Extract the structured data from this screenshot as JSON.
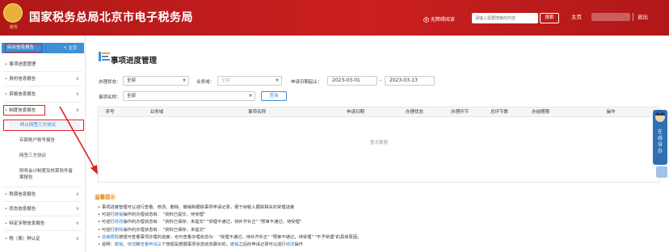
{
  "header": {
    "emblem_caption": "税务",
    "title": "国家税务总局北京市电子税务局",
    "accessibility": "无障碍阅读",
    "search_placeholder": "请输入需要搜索的内容",
    "search_button": "搜索",
    "home": "主页",
    "logout": "退出"
  },
  "sidebar": {
    "top_label": "综合信息报告",
    "home": "主页",
    "items": [
      {
        "label": "事项进度管理",
        "arrow": ""
      },
      {
        "label": "身份信息报告",
        "arrow": "∨"
      },
      {
        "label": "资格信息报告",
        "arrow": "∨"
      },
      {
        "label": "制度信息报告",
        "arrow": "∧"
      },
      {
        "label": "税源信息报告",
        "arrow": "∨"
      },
      {
        "label": "状态信息报告",
        "arrow": "∨"
      },
      {
        "label": "特定涉税信息报告",
        "arrow": "∨"
      },
      {
        "label": "税（费）种认定",
        "arrow": "∨"
      }
    ],
    "subitems": [
      "终止网签三方协议",
      "存款账户账号报告",
      "网签三方协议",
      "财务会计制度及核算软件备",
      "案报告"
    ]
  },
  "main": {
    "title": "事项进度管理",
    "filters": {
      "status_label": "办理状态：",
      "status_value": "全部",
      "domain_label": "业务域：",
      "domain_value": "全部",
      "date_label": "申请日期起止：",
      "date_from": "2023-03-01",
      "date_sep": "-",
      "date_to": "2023-03-13",
      "item_label": "事项名称：",
      "item_value": "全部",
      "query_button": "查询"
    },
    "table": {
      "columns": [
        "序号",
        "业务域",
        "事项名称",
        "申请日期",
        "办理状态",
        "办理环节",
        "总环节数",
        "办结期限",
        "操作"
      ],
      "empty_text": "暂无数据"
    }
  },
  "tips": {
    "title": "温馨提示",
    "lines": [
      [
        {
          "t": "事项进度管理可以进行查看、修改、删除、撤销和跟踪事项申请记录，便于纳税人跟踪相关的受理进度",
          "k": false
        }
      ],
      [
        {
          "t": "可进行",
          "k": false
        },
        {
          "t": "撤销",
          "k": true
        },
        {
          "t": "操作的办理状态有：  \"资料已提交，待受理\"",
          "k": false
        }
      ],
      [
        {
          "t": "可进行",
          "k": false
        },
        {
          "t": "修改",
          "k": true
        },
        {
          "t": "操作的办理状态有：  \"资料已保存，未提交\"    \"受理不通过，待补齐补正\"    \"预审不通过，待受理\"",
          "k": false
        }
      ],
      [
        {
          "t": "可进行",
          "k": false
        },
        {
          "t": "删除",
          "k": true
        },
        {
          "t": "操作的办理状态有：  \"资料已保存，未提交\"",
          "k": false
        }
      ],
      [
        {
          "t": "进度跟踪",
          "k": true
        },
        {
          "t": "按钮可查看事项办理的进度，也可查看办理状态为：  \"受理不通过，待补齐补正\"    \"预审不通过，待受理\"    \"不予受理\"的具体原因。",
          "k": false
        }
      ],
      [
        {
          "t": "说明：",
          "k": false
        },
        {
          "t": "撤销",
          "k": true
        },
        {
          "t": "、",
          "k": false
        },
        {
          "t": "修改",
          "k": true
        },
        {
          "t": "和",
          "k": false
        },
        {
          "t": "查看申请",
          "k": true
        },
        {
          "t": "三个按钮是根据事项状态动态展示的，",
          "k": false
        },
        {
          "t": "撤销",
          "k": true
        },
        {
          "t": "之后的申请记录可以进行",
          "k": false
        },
        {
          "t": "修改",
          "k": true
        },
        {
          "t": "操作",
          "k": false
        }
      ]
    ]
  },
  "float_panel": {
    "label_1": "在",
    "label_2": "线",
    "label_3": "导",
    "label_4": "办"
  },
  "colors": {
    "header_red": "#cc1f1f",
    "accent_blue": "#3d8fd6",
    "highlight_red": "#e02020",
    "tip_orange": "#e88a1a"
  }
}
